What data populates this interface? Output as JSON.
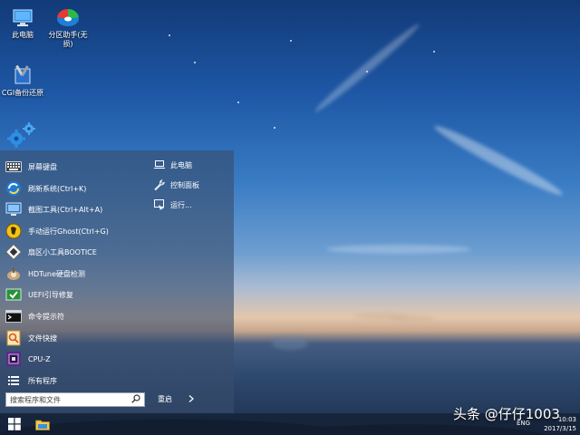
{
  "desktop": {
    "icons": [
      {
        "label": "此电脑"
      },
      {
        "label": "分区助手(无损)"
      },
      {
        "label": "CGI备份还原"
      }
    ]
  },
  "start_menu": {
    "items": [
      {
        "label": "屏幕键盘",
        "icon": "keyboard-icon"
      },
      {
        "label": "刷新系统(Ctrl+K)",
        "icon": "refresh-system-icon"
      },
      {
        "label": "截图工具(Ctrl+Alt+A)",
        "icon": "screenshot-tool-icon"
      },
      {
        "label": "手动运行Ghost(Ctrl+G)",
        "icon": "ghost-icon"
      },
      {
        "label": "扇区小工具BOOTICE",
        "icon": "bootice-icon"
      },
      {
        "label": "HDTune硬盘检测",
        "icon": "hdtune-icon"
      },
      {
        "label": "UEFI引导修复",
        "icon": "uefi-repair-icon"
      },
      {
        "label": "命令提示符",
        "icon": "command-prompt-icon"
      },
      {
        "label": "文件快搜",
        "icon": "file-search-icon"
      },
      {
        "label": "CPU-Z",
        "icon": "cpu-z-icon"
      },
      {
        "label": "所有程序",
        "icon": "all-programs-icon"
      }
    ],
    "right_items": [
      {
        "label": "此电脑",
        "icon": "computer-icon"
      },
      {
        "label": "控制面板",
        "icon": "wrench-icon"
      },
      {
        "label": "运行...",
        "icon": "run-icon"
      }
    ],
    "search": {
      "placeholder": "搜索程序和文件"
    },
    "restart_label": "重启"
  },
  "taskbar": {
    "language": "ENG",
    "time": "10:03",
    "date": "2017/3/15"
  },
  "watermark": "头条 @仔仔1003"
}
